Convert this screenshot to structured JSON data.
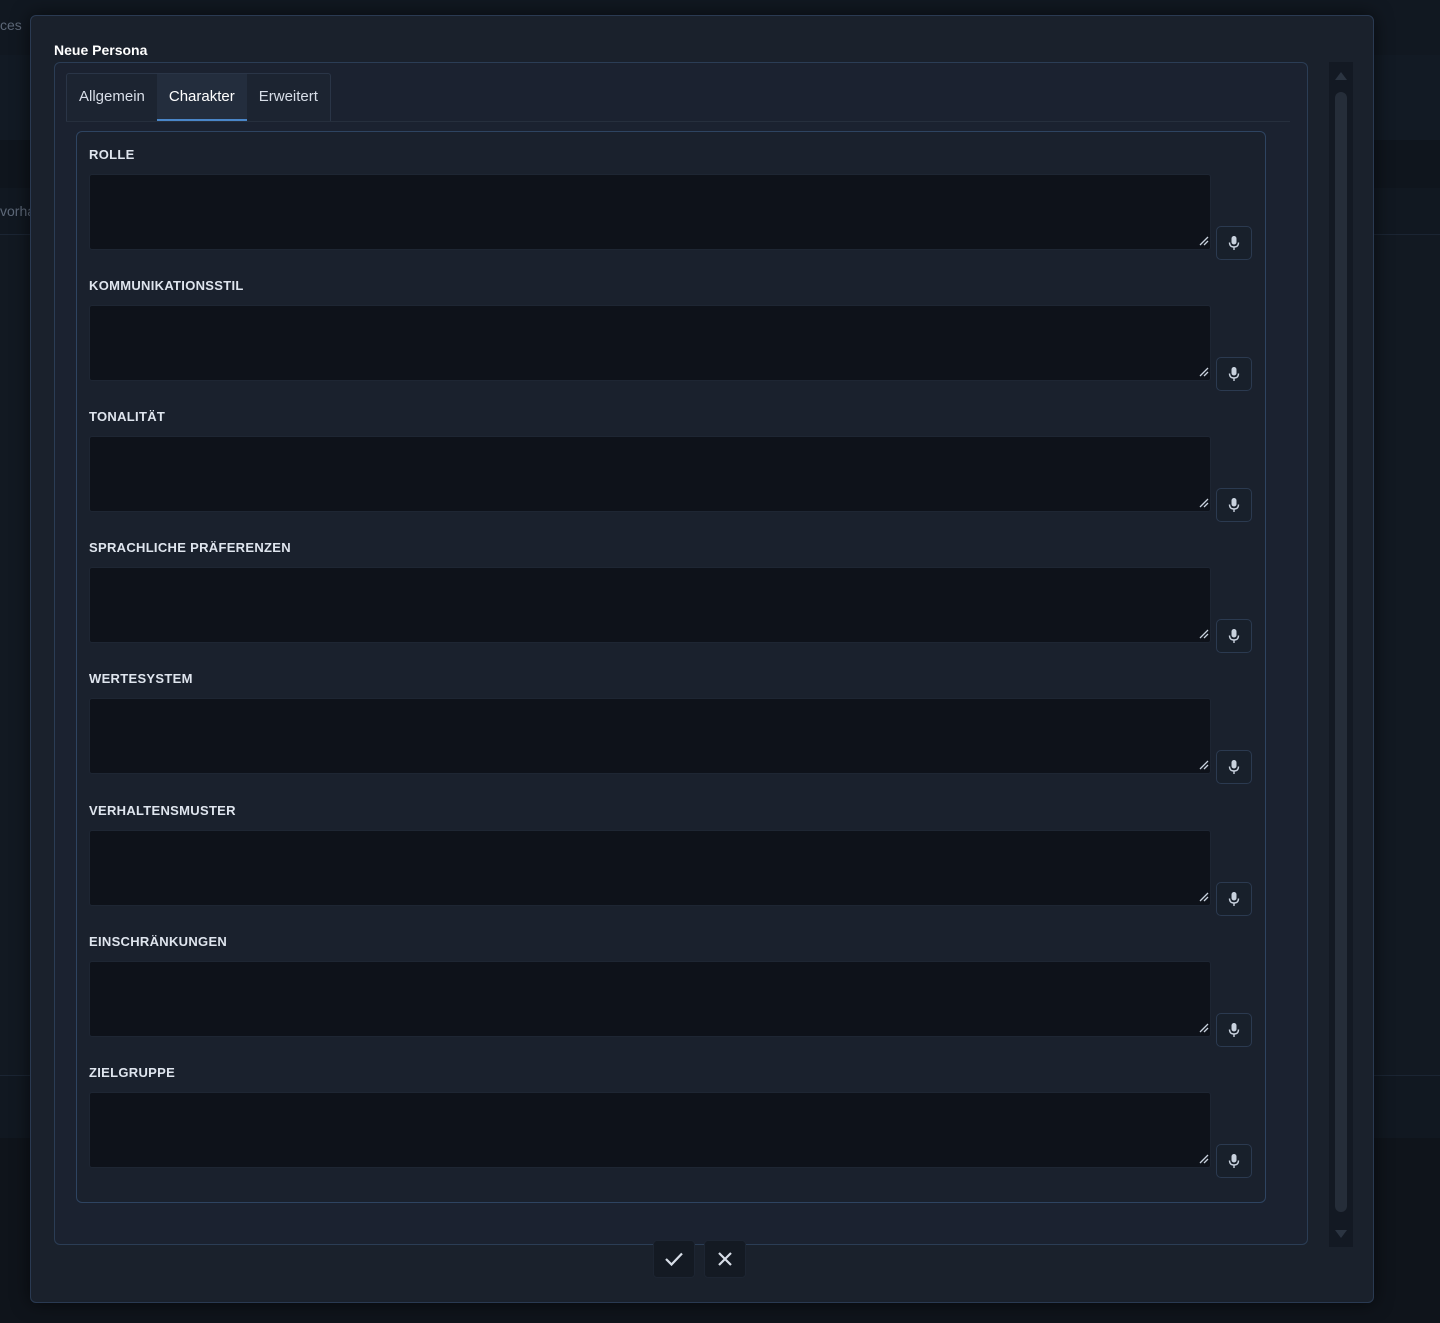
{
  "background": {
    "top_fragment": "ces",
    "side_fragment": "vorha"
  },
  "modal": {
    "title": "Neue Persona",
    "tabs": [
      {
        "label": "Allgemein",
        "active": false
      },
      {
        "label": "Charakter",
        "active": true
      },
      {
        "label": "Erweitert",
        "active": false
      }
    ],
    "fields": [
      {
        "label": "ROLLE",
        "value": ""
      },
      {
        "label": "KOMMUNIKATIONSSTIL",
        "value": ""
      },
      {
        "label": "TONALITÄT",
        "value": ""
      },
      {
        "label": "SPRACHLICHE PRÄFERENZEN",
        "value": ""
      },
      {
        "label": "WERTESYSTEM",
        "value": ""
      },
      {
        "label": "VERHALTENSMUSTER",
        "value": ""
      },
      {
        "label": "EINSCHRÄNKUNGEN",
        "value": ""
      },
      {
        "label": "ZIELGRUPPE",
        "value": ""
      }
    ],
    "field_action_icon": "microphone-icon",
    "footer": {
      "confirm_icon": "check-icon",
      "cancel_icon": "close-icon"
    }
  },
  "colors": {
    "accent": "#4a86c8",
    "panel_border": "#2e4461",
    "input_background": "#0e121a"
  }
}
